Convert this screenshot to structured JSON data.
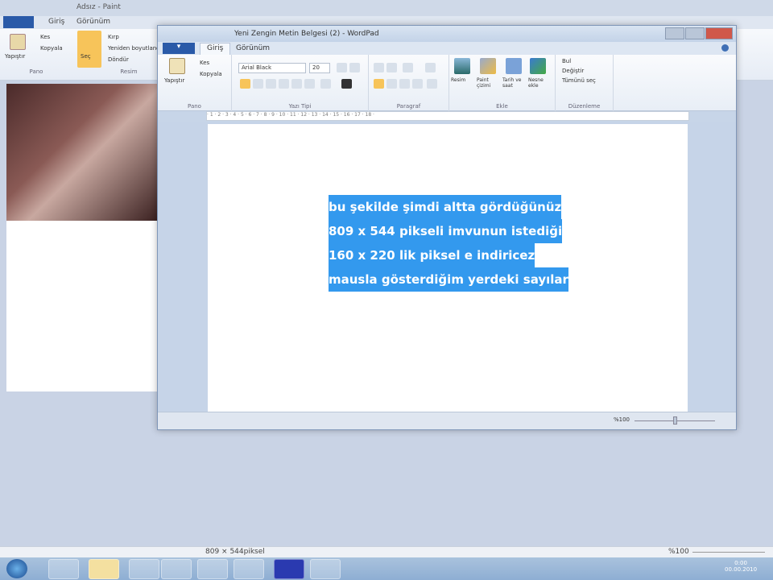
{
  "paint": {
    "title": "Adsız - Paint",
    "tabs": [
      "Giriş",
      "Görünüm"
    ],
    "groups": [
      "Pano",
      "Resim"
    ],
    "buttons": {
      "paste": "Yapıştır",
      "cut": "Kes",
      "copy": "Kopyala",
      "select": "Seç",
      "crop": "Kırp",
      "resize": "Yeniden boyutlandır",
      "rotate": "Döndür"
    },
    "status": {
      "size": "809 × 544piksel",
      "zoom": "%100"
    }
  },
  "wordpad": {
    "title": "Yeni Zengin Metin Belgesi (2) - WordPad",
    "tabs": [
      "Giriş",
      "Görünüm"
    ],
    "clipboard": {
      "paste": "Yapıştır",
      "cut": "Kes",
      "copy": "Kopyala",
      "label": "Pano"
    },
    "font": {
      "name": "Arial Black",
      "size": "20",
      "label": "Yazı Tipi"
    },
    "paragraph": {
      "label": "Paragraf"
    },
    "insert": {
      "picture": "Resim",
      "paint": "Paint çizimi",
      "datetime": "Tarih ve saat",
      "object": "Nesne ekle",
      "label": "Ekle"
    },
    "editing": {
      "find": "Bul",
      "replace": "Değiştir",
      "select_all": "Tümünü seç",
      "label": "Düzenleme"
    },
    "ruler": "· 1 · 2 · 3 · 4 · 5 · 6 · 7 · 8 · 9 · 10 · 11 · 12 · 13 · 14 · 15 · 16 · 17 · 18 ·",
    "document_lines": [
      "bu şekilde şimdi altta gördüğünüz",
      "809 x 544 pikseli imvunun istediği",
      "160 x 220 lik piksel e indiricez",
      "mausla gösterdiğim yerdeki sayılar"
    ],
    "zoom": "%100"
  },
  "taskbar": {
    "clock_time": "0:00",
    "clock_date": "00.00.2010"
  }
}
